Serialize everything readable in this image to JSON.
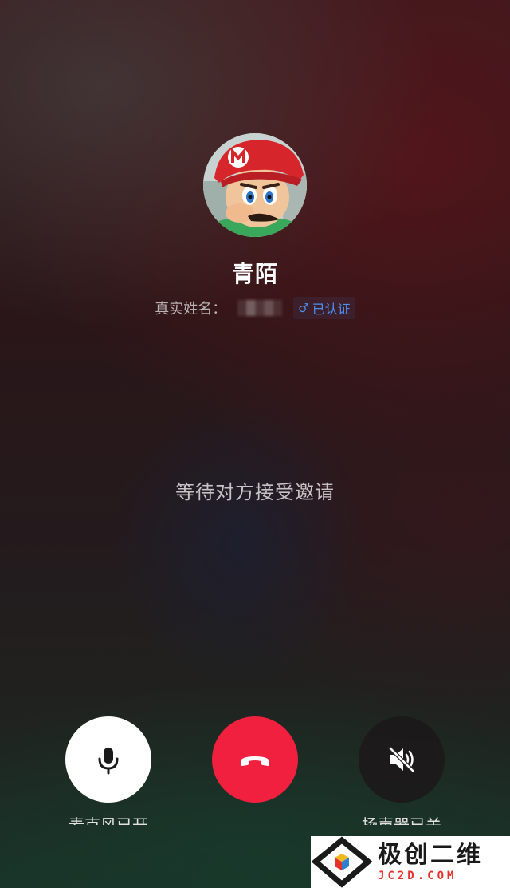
{
  "caller": {
    "name": "青陌",
    "realname_label": "真实姓名：",
    "verified_label": "已认证",
    "gender_symbol": "♂"
  },
  "call": {
    "status": "等待对方接受邀请"
  },
  "controls": {
    "mic_label": "麦克风已开",
    "speaker_label": "扬声器已关",
    "hangup_color": "#f0203e"
  },
  "watermark": {
    "title": "极创二维",
    "url": "JC2D.COM"
  },
  "colors": {
    "accent_blue": "#4d8ff0",
    "hangup_red": "#f0203e"
  },
  "icons": {
    "mic": "microphone-icon",
    "hangup": "phone-hangup-icon",
    "speaker": "speaker-muted-icon"
  }
}
